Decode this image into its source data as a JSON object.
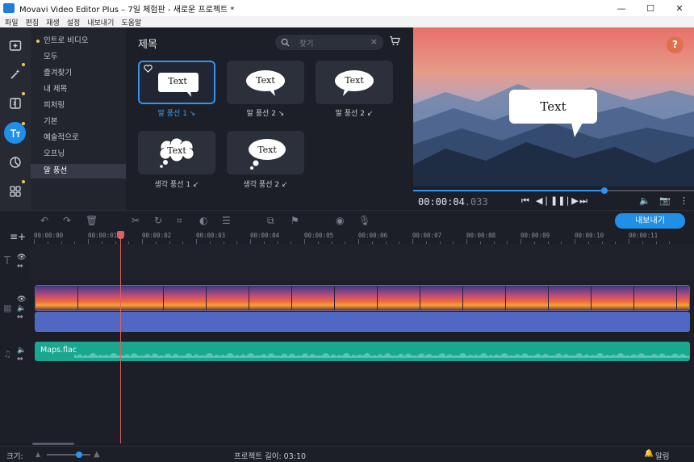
{
  "window": {
    "title": "Movavi Video Editor Plus – 7일 체험판 - 새로운 프로젝트 *",
    "minimize": "—",
    "maximize": "☐",
    "close": "✕"
  },
  "menu": [
    "파일",
    "편집",
    "재생",
    "설정",
    "내보내기",
    "도움말"
  ],
  "rail": [
    "import-icon",
    "magic-wand-icon",
    "transitions-icon",
    "titles-icon",
    "filters-icon",
    "more-tools-icon"
  ],
  "categories": [
    {
      "label": "인트로 비디오",
      "dot": true
    },
    {
      "label": "모두",
      "dot": false
    },
    {
      "label": "즐겨찾기",
      "dot": false
    },
    {
      "label": "내 제목",
      "dot": false
    },
    {
      "label": "피처링",
      "dot": false
    },
    {
      "label": "기본",
      "dot": false
    },
    {
      "label": "예술적으로",
      "dot": false
    },
    {
      "label": "오프닝",
      "dot": false
    },
    {
      "label": "말 풍선",
      "dot": false
    }
  ],
  "gallery": {
    "title": "제목",
    "search_placeholder": "찾기",
    "tiles": [
      {
        "label": "말 풍선 1 ↘",
        "text": "Text",
        "selected": true
      },
      {
        "label": "말 풍선 2 ↘",
        "text": "Text",
        "selected": false
      },
      {
        "label": "말 풍선 2 ↙",
        "text": "Text",
        "selected": false
      },
      {
        "label": "생각 풍선 1 ↙",
        "text": "Text",
        "selected": false
      },
      {
        "label": "생각 풍선 2 ↙",
        "text": "Text",
        "selected": false
      }
    ]
  },
  "preview": {
    "help": "?",
    "bubble_text": "Text",
    "timecode_main": "00:00:04",
    "timecode_ms": ".033",
    "progress": 0.68
  },
  "timeline": {
    "export_label": "내보내기",
    "ruler": [
      "00:00:00",
      "00:00:01",
      "00:00:02",
      "00:00:03",
      "00:00:04",
      "00:00:05",
      "00:00:06",
      "00:00:07",
      "00:00:08",
      "00:00:09",
      "00:00:10",
      "00:00:11"
    ],
    "music_clip": "Maps.flac"
  },
  "status": {
    "zoom_label": "크기:",
    "project_length": "프로젝트 길이: 03:10",
    "notifications": "알림"
  },
  "colors": {
    "accent": "#1f8fe8",
    "playhead": "#e0605c",
    "audio_track": "#5068c2",
    "music_track": "#19a790"
  }
}
